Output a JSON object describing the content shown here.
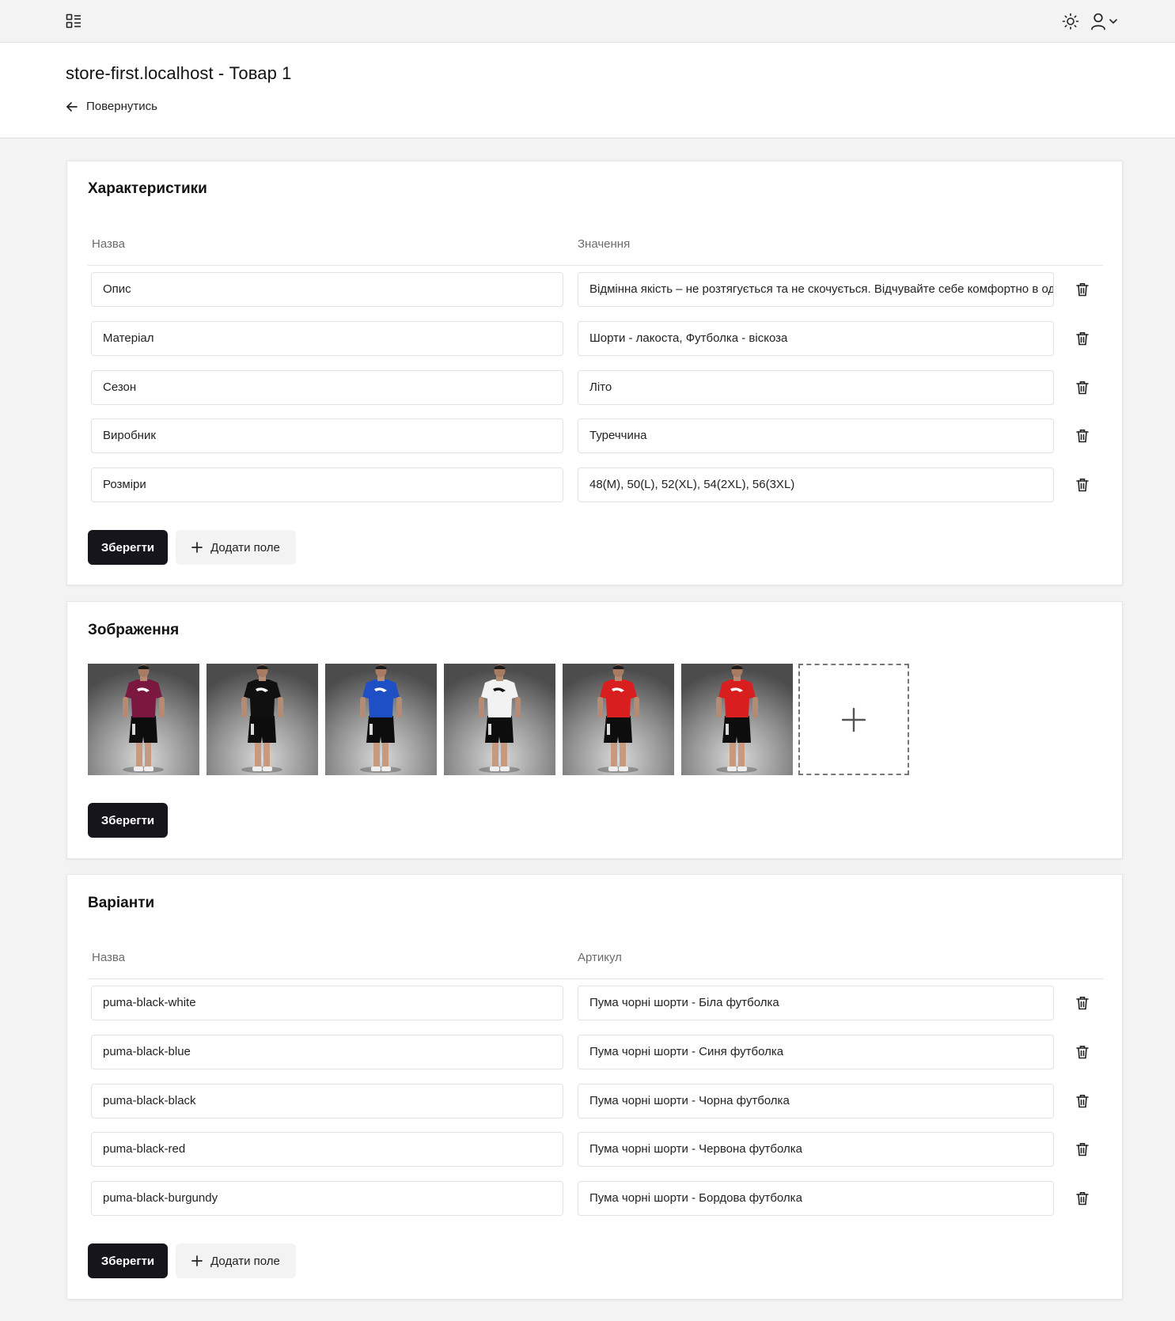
{
  "page": {
    "title": "store-first.localhost - Товар 1",
    "back_label": "Повернутись"
  },
  "characteristics": {
    "title": "Характеристики",
    "col_name": "Назва",
    "col_value": "Значення",
    "rows": [
      {
        "name": "Опис",
        "value": "Відмінна якість – не розтягується та не скочується. Відчувайте себе комфортно в одязі"
      },
      {
        "name": "Матеріал",
        "value": "Шорти - лакоста, Футболка - віскоза"
      },
      {
        "name": "Сезон",
        "value": "Літо"
      },
      {
        "name": "Виробник",
        "value": "Туреччина"
      },
      {
        "name": "Розміри",
        "value": "48(M), 50(L), 52(XL), 54(2XL), 56(3XL)"
      }
    ],
    "save_label": "Зберегти",
    "add_label": "Додати поле"
  },
  "images": {
    "title": "Зображення",
    "items": [
      {
        "name": "burgundy-tshirt-photo",
        "shirt_color": "#7a1840"
      },
      {
        "name": "black-tshirt-photo",
        "shirt_color": "#101010"
      },
      {
        "name": "blue-tshirt-photo",
        "shirt_color": "#1f4fc4"
      },
      {
        "name": "white-tshirt-photo",
        "shirt_color": "#f2f2f2"
      },
      {
        "name": "red-tshirt-photo-1",
        "shirt_color": "#d81e1e"
      },
      {
        "name": "red-tshirt-photo-2",
        "shirt_color": "#d81e1e"
      }
    ],
    "save_label": "Зберегти"
  },
  "variants": {
    "title": "Варіанти",
    "col_name": "Назва",
    "col_sku": "Артикул",
    "rows": [
      {
        "name": "puma-black-white",
        "sku": "Пума чорні шорти - Біла футболка"
      },
      {
        "name": "puma-black-blue",
        "sku": "Пума чорні шорти - Синя футболка"
      },
      {
        "name": "puma-black-black",
        "sku": "Пума чорні шорти - Чорна футболка"
      },
      {
        "name": "puma-black-red",
        "sku": "Пума чорні шорти - Червона футболка"
      },
      {
        "name": "puma-black-burgundy",
        "sku": "Пума чорні шорти - Бордова футболка"
      }
    ],
    "save_label": "Зберегти",
    "add_label": "Додати поле"
  },
  "icons": {
    "menu": "dashboard-menu-icon",
    "theme": "sun-icon",
    "user": "user-icon",
    "chevron": "chevron-down-icon",
    "back": "arrow-left-icon",
    "trash": "trash-icon",
    "plus": "plus-icon"
  }
}
